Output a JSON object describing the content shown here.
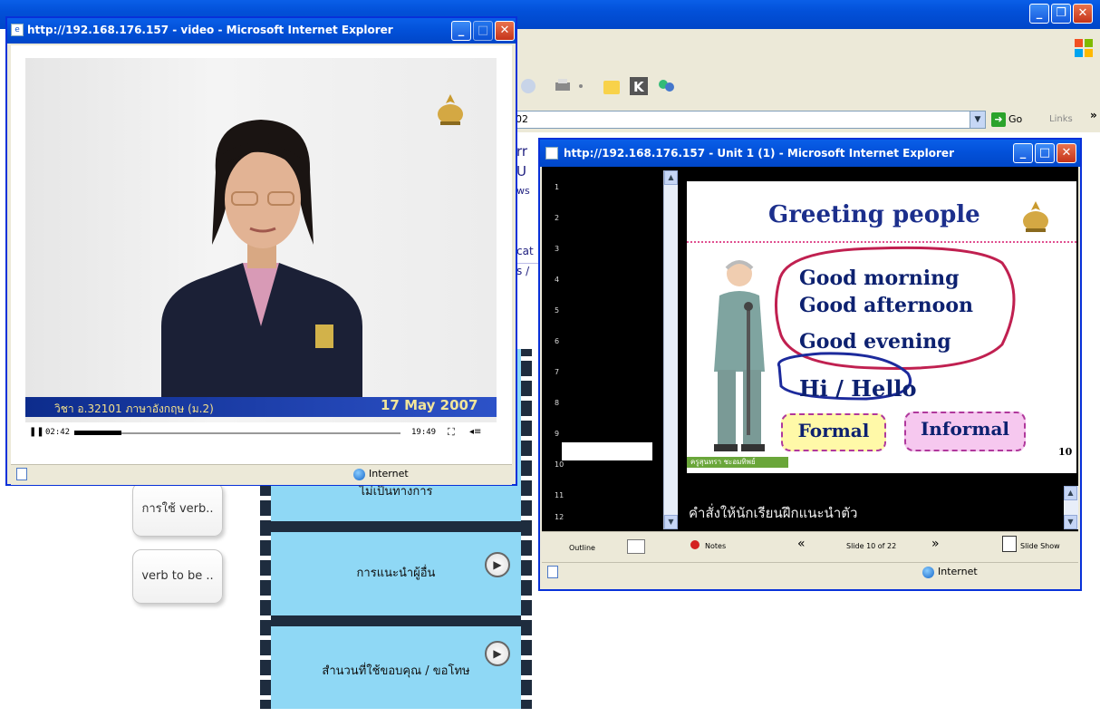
{
  "background_window": {
    "address_fragment": "02",
    "go_label": "Go",
    "links_label": "Links",
    "links_chevron": "»",
    "partial_text_lines": [
      "rr",
      "U",
      "ws",
      "",
      "",
      "cat",
      "s /"
    ],
    "left_buttons": [
      "การใช้ verb..",
      "verb to be .."
    ],
    "film_items": [
      {
        "label": "ไม่เป็นทางการ",
        "has_play": false
      },
      {
        "label": "การแนะนำผู้อื่น",
        "has_play": true
      },
      {
        "label": "สำนวนที่ใช้ขอบคุณ / ขอโทษ",
        "has_play": true
      }
    ]
  },
  "video_window": {
    "title": "http://192.168.176.157 - video - Microsoft Internet Explorer",
    "caption_left": "วิชา อ.32101 ภาษาอังกฤษ (ม.2)",
    "caption_date": "17 May 2007",
    "time_elapsed": "02:42",
    "time_total": "19:49",
    "status_zone": "Internet"
  },
  "ppt_window": {
    "title": "http://192.168.176.157 - Unit 1 (1) - Microsoft Internet Explorer",
    "outline_numbers": [
      "1",
      "2",
      "3",
      "4",
      "5",
      "6",
      "7",
      "8",
      "9",
      "10",
      "11",
      "12"
    ],
    "slide": {
      "title": "Greeting people",
      "lines": [
        "Good morning",
        "Good afternoon",
        "Good evening",
        "Hi / Hello"
      ],
      "boxes": [
        "Formal",
        "Informal"
      ],
      "page_number": "10",
      "footer": "ครูสุนทรา ชะอมทิพย์"
    },
    "notes_text": "คำสั่งให้นักเรียนฝึกแนะนำตัว",
    "nav": {
      "outline_label": "Outline",
      "notes_label": "Notes",
      "slide_counter": "Slide 10 of 22",
      "slideshow_label": "Slide Show",
      "prev_symbol": "«",
      "next_symbol": "»"
    },
    "status_zone": "Internet"
  },
  "colors": {
    "xp_title_blue": "#0250d8",
    "film_cell": "#8fd8f5",
    "slide_title": "#1c2f8c",
    "highlight_red": "#c02050"
  }
}
